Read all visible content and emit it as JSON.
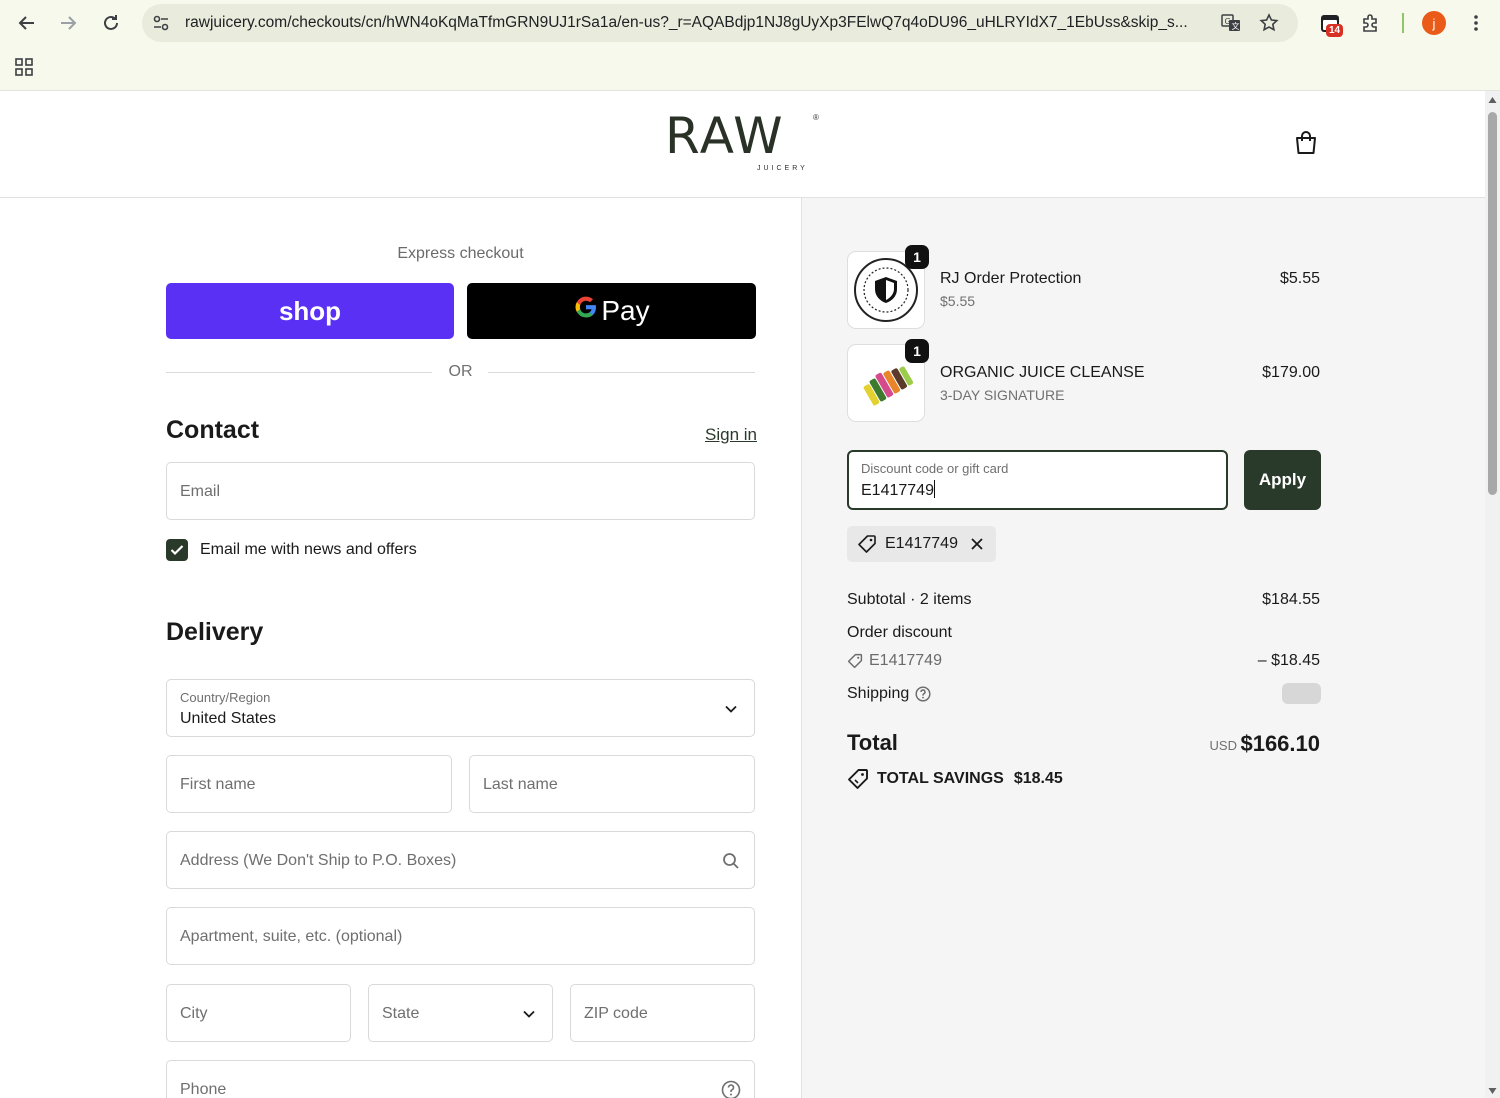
{
  "browser": {
    "url": "rawjuicery.com/checkouts/cn/hWN4oKqMaTfmGRN9UJ1rSa1a/en-us?_r=AQABdjp1NJ8gUyXp3FElwQ7q4oDU96_uHLRYIdX7_1EbUss&skip_s...",
    "extensions_badge": "14",
    "profile_initial": "j"
  },
  "header": {
    "logo_text": "RAW",
    "logo_sub": "JUICERY",
    "logo_reg": "®"
  },
  "express": {
    "label": "Express checkout",
    "shop_label": "shop",
    "gpay_g": "G",
    "gpay_label": "Pay",
    "or": "OR"
  },
  "contact": {
    "title": "Contact",
    "signin": "Sign in",
    "email_placeholder": "Email",
    "news_label": "Email me with news and offers",
    "news_checked": true
  },
  "delivery": {
    "title": "Delivery",
    "country_label": "Country/Region",
    "country_value": "United States",
    "first_name": "First name",
    "last_name": "Last name",
    "address": "Address (We Don't Ship to P.O. Boxes)",
    "apartment": "Apartment, suite, etc. (optional)",
    "city": "City",
    "state": "State",
    "zip": "ZIP code",
    "phone": "Phone"
  },
  "order": {
    "items": [
      {
        "name": "RJ Order Protection",
        "sub": "$5.55",
        "price": "$5.55",
        "qty": "1"
      },
      {
        "name": "ORGANIC JUICE CLEANSE",
        "sub": "3-DAY SIGNATURE",
        "price": "$179.00",
        "qty": "1"
      }
    ],
    "discount_label": "Discount code or gift card",
    "discount_value": "E1417749",
    "apply": "Apply",
    "applied_code": "E1417749",
    "subtotal_label": "Subtotal · 2 items",
    "subtotal_value": "$184.55",
    "order_discount_label": "Order discount",
    "order_discount_code": "E1417749",
    "order_discount_value": "– $18.45",
    "shipping_label": "Shipping",
    "total_label": "Total",
    "currency": "USD",
    "total_value": "$166.10",
    "savings_label": "TOTAL SAVINGS",
    "savings_value": "$18.45"
  },
  "colors": {
    "shop_purple": "#5a31f4",
    "accent_dark_green": "#2a3a2a"
  }
}
